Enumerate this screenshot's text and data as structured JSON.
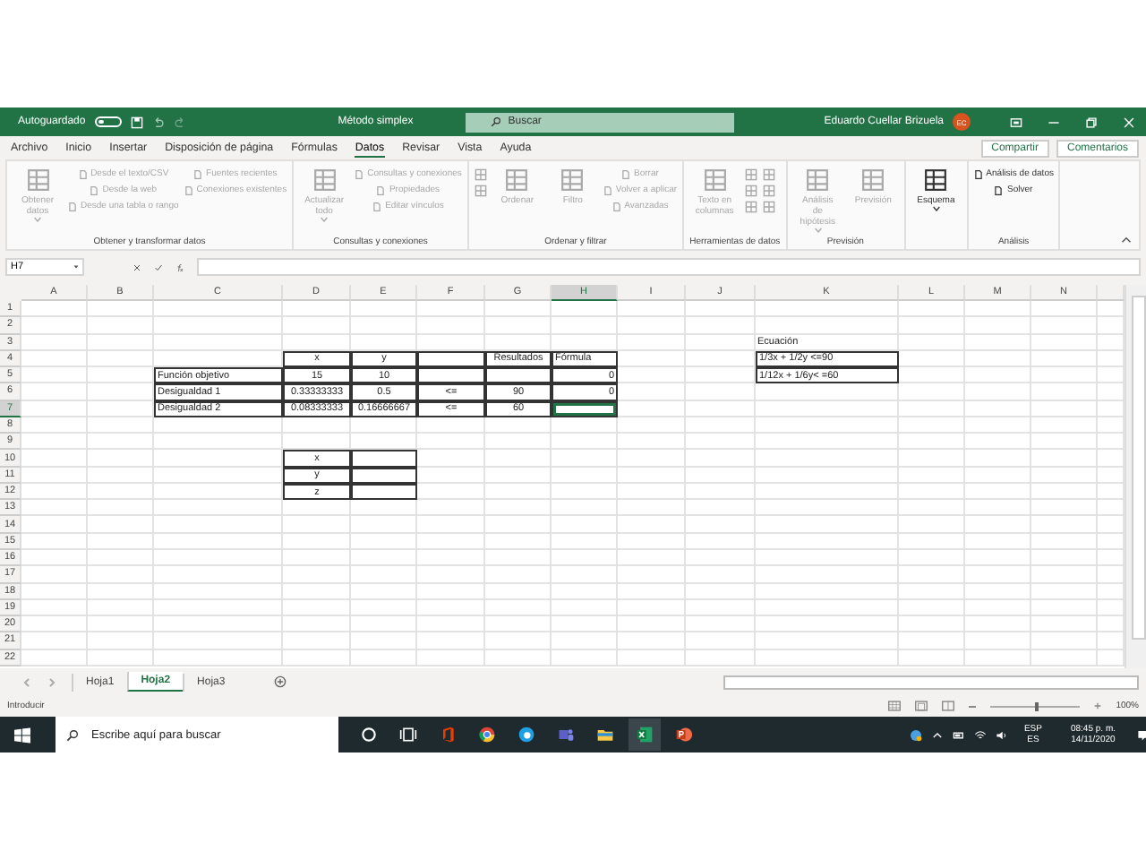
{
  "title_bar": {
    "autosave_label": "Autoguardado",
    "autosave_on": false,
    "document": "Método simplex",
    "search_placeholder": "Buscar",
    "user": "Eduardo Cuellar Brizuela",
    "avatar_initials": "EC"
  },
  "menu_tabs": [
    {
      "label": "Archivo",
      "selected": false
    },
    {
      "label": "Inicio",
      "selected": false
    },
    {
      "label": "Insertar",
      "selected": false
    },
    {
      "label": "Disposición de página",
      "selected": false
    },
    {
      "label": "Fórmulas",
      "selected": false
    },
    {
      "label": "Datos",
      "selected": true
    },
    {
      "label": "Revisar",
      "selected": false
    },
    {
      "label": "Vista",
      "selected": false
    },
    {
      "label": "Ayuda",
      "selected": false
    }
  ],
  "share_button": "Compartir",
  "comments_button": "Comentarios",
  "ribbon_groups": [
    {
      "label": "Obtener y transformar datos",
      "stacks": [
        {
          "kind": "large",
          "items": [
            {
              "label": "Obtener datos",
              "disabled": true,
              "dropdown": true
            }
          ]
        },
        {
          "kind": "small",
          "items": [
            {
              "label": "Desde el texto/CSV",
              "disabled": true
            },
            {
              "label": "Desde la web",
              "disabled": true
            },
            {
              "label": "Desde una tabla o rango",
              "disabled": true
            }
          ]
        },
        {
          "kind": "small",
          "items": [
            {
              "label": "Fuentes recientes",
              "disabled": true
            },
            {
              "label": "Conexiones existentes",
              "disabled": true
            }
          ]
        }
      ]
    },
    {
      "label": "Consultas y conexiones",
      "stacks": [
        {
          "kind": "large",
          "items": [
            {
              "label": "Actualizar todo",
              "disabled": true,
              "dropdown": true
            }
          ]
        },
        {
          "kind": "small",
          "items": [
            {
              "label": "Consultas y conexiones",
              "disabled": true
            },
            {
              "label": "Propiedades",
              "disabled": true
            },
            {
              "label": "Editar vínculos",
              "disabled": true
            }
          ]
        }
      ]
    },
    {
      "label": "Ordenar y filtrar",
      "stacks": [
        {
          "kind": "icons",
          "items": [
            {
              "disabled": true
            },
            {
              "disabled": true
            }
          ]
        },
        {
          "kind": "large",
          "items": [
            {
              "label": "Ordenar",
              "disabled": true
            }
          ]
        },
        {
          "kind": "large",
          "items": [
            {
              "label": "Filtro",
              "disabled": true
            }
          ]
        },
        {
          "kind": "small",
          "items": [
            {
              "label": "Borrar",
              "disabled": true
            },
            {
              "label": "Volver a aplicar",
              "disabled": true
            },
            {
              "label": "Avanzadas",
              "disabled": true
            }
          ]
        }
      ]
    },
    {
      "label": "Herramientas de datos",
      "stacks": [
        {
          "kind": "large",
          "items": [
            {
              "label": "Texto en columnas",
              "disabled": true
            }
          ]
        },
        {
          "kind": "icons",
          "items": [
            {
              "disabled": true
            },
            {
              "disabled": true
            },
            {
              "disabled": true
            }
          ]
        },
        {
          "kind": "icons",
          "items": [
            {
              "disabled": true
            },
            {
              "disabled": true
            },
            {
              "disabled": true
            }
          ]
        }
      ]
    },
    {
      "label": "Previsión",
      "stacks": [
        {
          "kind": "large",
          "items": [
            {
              "label": "Análisis de hipótesis",
              "disabled": true,
              "dropdown": true
            }
          ]
        },
        {
          "kind": "large",
          "items": [
            {
              "label": "Previsión",
              "disabled": true
            }
          ]
        }
      ]
    },
    {
      "stacks": [
        {
          "kind": "large",
          "items": [
            {
              "label": "Esquema",
              "disabled": false,
              "dropdown": true
            }
          ]
        }
      ]
    },
    {
      "label": "Análisis",
      "stacks": [
        {
          "kind": "small",
          "items": [
            {
              "label": "Análisis de datos",
              "disabled": false
            },
            {
              "label": "Solver",
              "disabled": false
            }
          ]
        }
      ]
    }
  ],
  "formula_bar": {
    "name_box": "H7"
  },
  "columns": [
    {
      "label": "A",
      "selected": false
    },
    {
      "label": "B",
      "selected": false
    },
    {
      "label": "C",
      "selected": false
    },
    {
      "label": "D",
      "selected": false
    },
    {
      "label": "E",
      "selected": false
    },
    {
      "label": "F",
      "selected": false
    },
    {
      "label": "G",
      "selected": false
    },
    {
      "label": "H",
      "selected": true
    },
    {
      "label": "I",
      "selected": false
    },
    {
      "label": "J",
      "selected": false
    },
    {
      "label": "K",
      "selected": false
    },
    {
      "label": "L",
      "selected": false
    },
    {
      "label": "M",
      "selected": false
    },
    {
      "label": "N",
      "selected": false
    }
  ],
  "rows": [
    {
      "label": "1",
      "selected": false
    },
    {
      "label": "2",
      "selected": false
    },
    {
      "label": "3",
      "selected": false,
      "cells": [
        {
          "bordered": false
        },
        {
          "bordered": false
        },
        {
          "bordered": false
        },
        {
          "bordered": false
        },
        {
          "bordered": false
        },
        {
          "bordered": false
        },
        {
          "bordered": false
        },
        {
          "bordered": false
        },
        {
          "bordered": false
        },
        {
          "bordered": false
        },
        {
          "text": "Ecuación",
          "kind": "label",
          "bordered": false
        },
        {
          "bordered": false
        },
        {
          "bordered": false
        },
        {
          "bordered": false
        }
      ]
    },
    {
      "label": "4",
      "selected": false,
      "cells": [
        {
          "bordered": false
        },
        {
          "bordered": false
        },
        {
          "bordered": false
        },
        {
          "text": "x",
          "kind": "centered",
          "bordered": true
        },
        {
          "text": "y",
          "kind": "centered",
          "bordered": true
        },
        {
          "bordered": true
        },
        {
          "text": "Resultados",
          "kind": "centered",
          "bordered": true
        },
        {
          "text": "Fórmula",
          "kind": "label",
          "bordered": true
        },
        {
          "bordered": false
        },
        {
          "bordered": false
        },
        {
          "text": "1/3x + 1/2y <=90",
          "kind": "label",
          "bordered": true
        },
        {
          "bordered": false
        },
        {
          "bordered": false
        },
        {
          "bordered": false
        }
      ]
    },
    {
      "label": "5",
      "selected": false,
      "cells": [
        {
          "bordered": false
        },
        {
          "bordered": false
        },
        {
          "text": "Función objetivo",
          "kind": "label",
          "bordered": true
        },
        {
          "text": "15",
          "kind": "centered",
          "bordered": true
        },
        {
          "text": "10",
          "kind": "centered",
          "bordered": true
        },
        {
          "bordered": true
        },
        {
          "bordered": true
        },
        {
          "text": "0",
          "kind": "number",
          "bordered": true
        },
        {
          "bordered": false
        },
        {
          "bordered": false
        },
        {
          "text": "1/12x + 1/6y< =60",
          "kind": "label",
          "bordered": true
        },
        {
          "bordered": false
        },
        {
          "bordered": false
        },
        {
          "bordered": false
        }
      ]
    },
    {
      "label": "6",
      "selected": false,
      "cells": [
        {
          "bordered": false
        },
        {
          "bordered": false
        },
        {
          "text": "Desigualdad 1",
          "kind": "label",
          "bordered": true
        },
        {
          "text": "0.33333333",
          "kind": "centered",
          "bordered": true
        },
        {
          "text": "0.5",
          "kind": "centered",
          "bordered": true
        },
        {
          "text": "<=",
          "kind": "centered",
          "bordered": true
        },
        {
          "text": "90",
          "kind": "centered",
          "bordered": true
        },
        {
          "text": "0",
          "kind": "number",
          "bordered": true
        },
        {
          "bordered": false
        },
        {
          "bordered": false
        },
        {
          "bordered": false
        },
        {
          "bordered": false
        },
        {
          "bordered": false
        },
        {
          "bordered": false
        }
      ]
    },
    {
      "label": "7",
      "selected": true,
      "cells": [
        {
          "bordered": false
        },
        {
          "bordered": false
        },
        {
          "text": "Desigualdad 2",
          "kind": "label",
          "bordered": true
        },
        {
          "text": "0.08333333",
          "kind": "centered",
          "bordered": true
        },
        {
          "text": "0.16666667",
          "kind": "centered",
          "bordered": true
        },
        {
          "text": "<=",
          "kind": "centered",
          "bordered": true
        },
        {
          "text": "60",
          "kind": "centered",
          "bordered": true
        },
        {
          "bordered": true
        },
        {
          "bordered": false
        },
        {
          "bordered": false
        },
        {
          "bordered": false
        },
        {
          "bordered": false
        },
        {
          "bordered": false
        },
        {
          "bordered": false
        }
      ]
    },
    {
      "label": "8",
      "selected": false
    },
    {
      "label": "9",
      "selected": false
    },
    {
      "label": "10",
      "selected": false,
      "cells": [
        {
          "bordered": false
        },
        {
          "bordered": false
        },
        {
          "bordered": false
        },
        {
          "text": "x",
          "kind": "centered",
          "bordered": true
        },
        {
          "bordered": true
        },
        {
          "bordered": false
        },
        {
          "bordered": false
        },
        {
          "bordered": false
        },
        {
          "bordered": false
        },
        {
          "bordered": false
        },
        {
          "bordered": false
        },
        {
          "bordered": false
        },
        {
          "bordered": false
        },
        {
          "bordered": false
        }
      ]
    },
    {
      "label": "11",
      "selected": false,
      "cells": [
        {
          "bordered": false
        },
        {
          "bordered": false
        },
        {
          "bordered": false
        },
        {
          "text": "y",
          "kind": "centered",
          "bordered": true
        },
        {
          "bordered": true
        },
        {
          "bordered": false
        },
        {
          "bordered": false
        },
        {
          "bordered": false
        },
        {
          "bordered": false
        },
        {
          "bordered": false
        },
        {
          "bordered": false
        },
        {
          "bordered": false
        },
        {
          "bordered": false
        },
        {
          "bordered": false
        }
      ]
    },
    {
      "label": "12",
      "selected": false,
      "cells": [
        {
          "bordered": false
        },
        {
          "bordered": false
        },
        {
          "bordered": false
        },
        {
          "text": "z",
          "kind": "centered",
          "bordered": true
        },
        {
          "bordered": true
        },
        {
          "bordered": false
        },
        {
          "bordered": false
        },
        {
          "bordered": false
        },
        {
          "bordered": false
        },
        {
          "bordered": false
        },
        {
          "bordered": false
        },
        {
          "bordered": false
        },
        {
          "bordered": false
        },
        {
          "bordered": false
        }
      ]
    },
    {
      "label": "13",
      "selected": false
    },
    {
      "label": "14",
      "selected": false
    },
    {
      "label": "15",
      "selected": false
    },
    {
      "label": "16",
      "selected": false
    },
    {
      "label": "17",
      "selected": false
    },
    {
      "label": "18",
      "selected": false
    },
    {
      "label": "19",
      "selected": false
    },
    {
      "label": "20",
      "selected": false
    },
    {
      "label": "21",
      "selected": false
    },
    {
      "label": "22",
      "selected": false
    }
  ],
  "sheet_tabs": [
    {
      "label": "Hoja1",
      "selected": false
    },
    {
      "label": "Hoja2",
      "selected": true
    },
    {
      "label": "Hoja3",
      "selected": false
    }
  ],
  "status_bar": {
    "mode": "Introducir",
    "zoom": "100%",
    "zoom_slider": {
      "level": 0.5
    }
  },
  "taskbar": {
    "search_placeholder": "Escribe aquí para buscar",
    "language": "ESP",
    "layout": "ES",
    "time": "08:45 p. m.",
    "date": "14/11/2020"
  }
}
